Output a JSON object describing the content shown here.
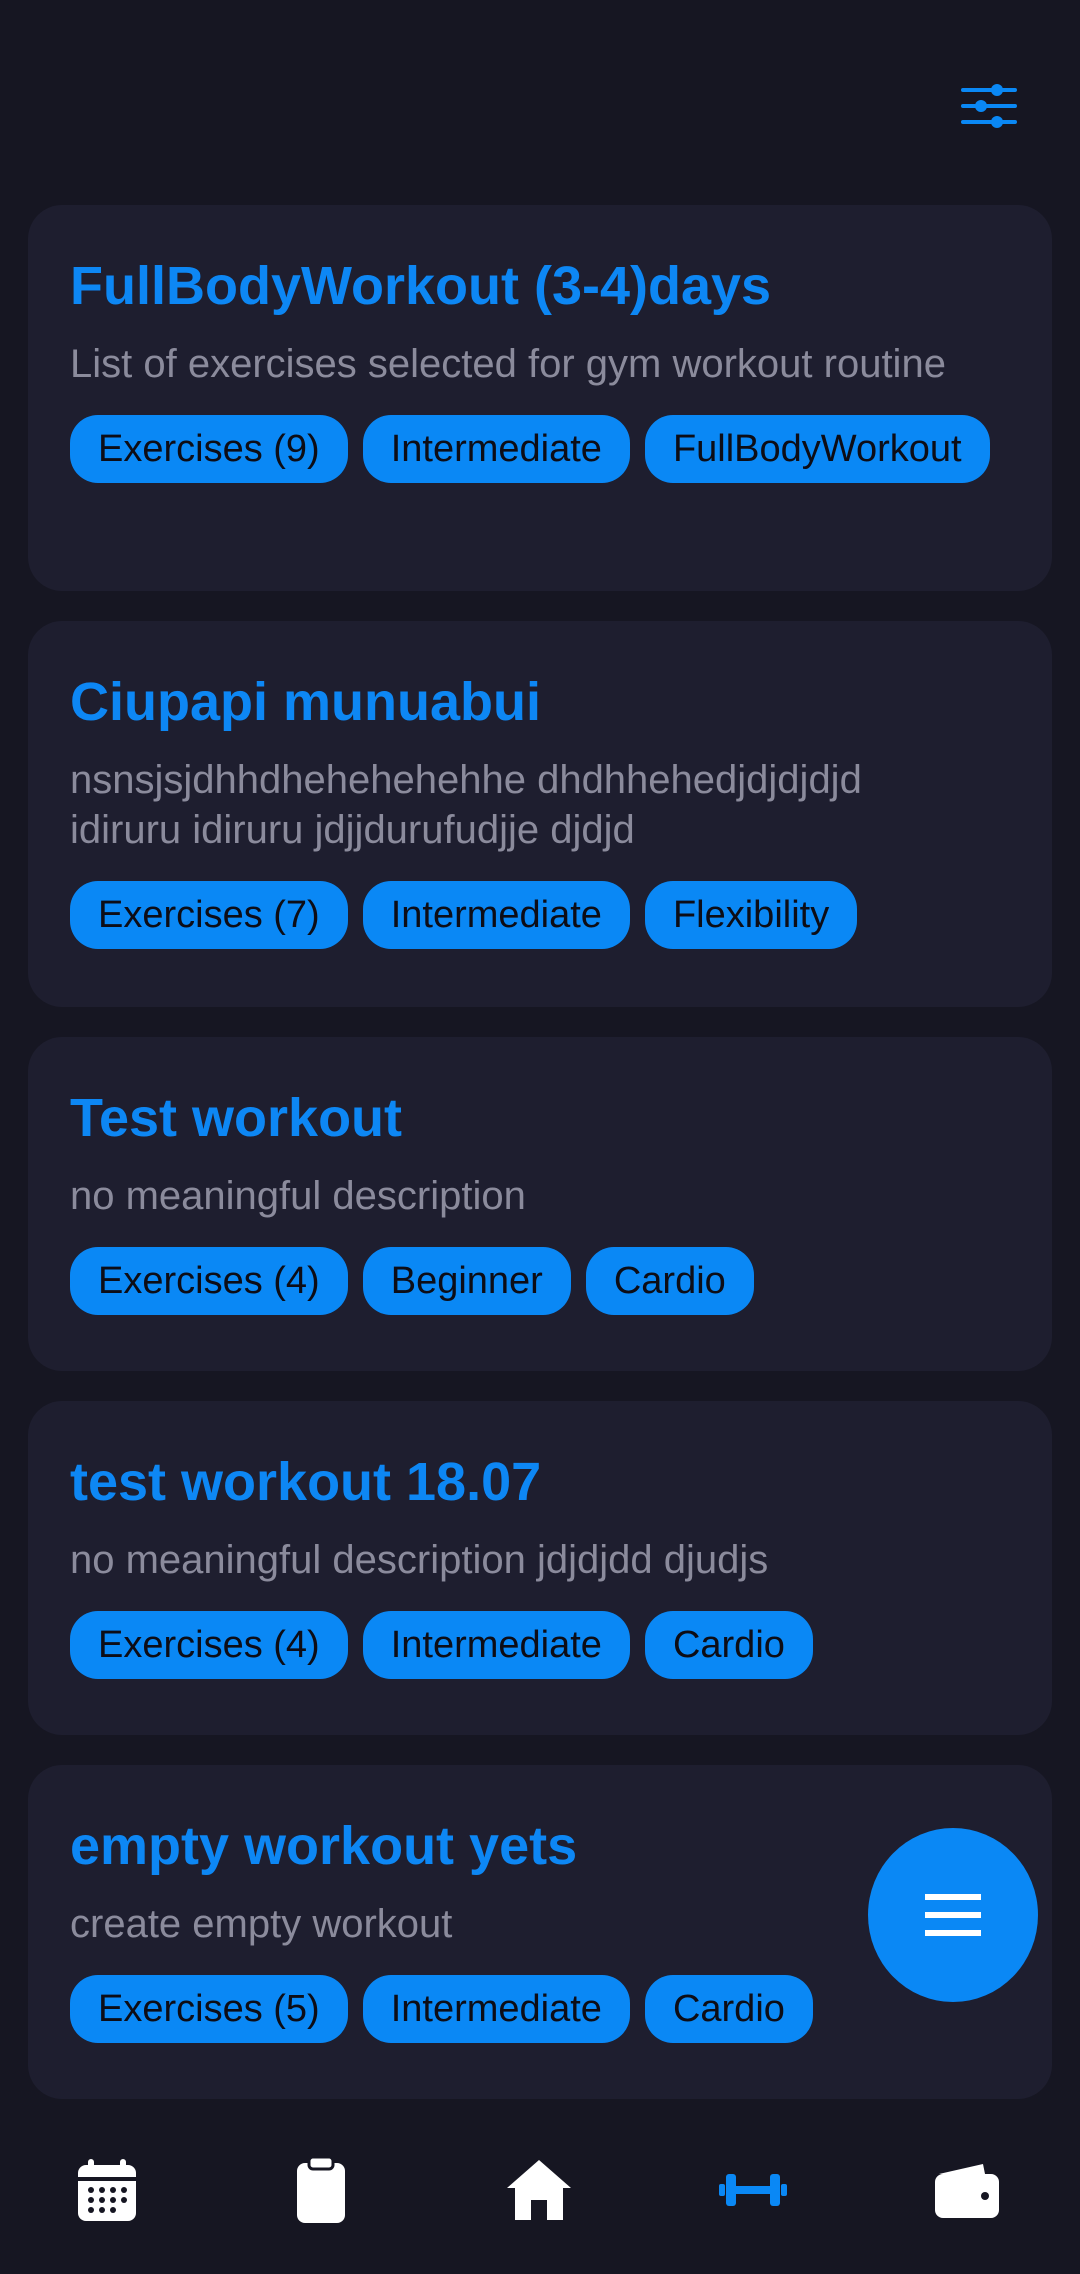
{
  "colors": {
    "background": "#161622",
    "card": "#1e1e2f",
    "accent": "#0a88f5",
    "title": "#0d87f4",
    "description": "#8b8b9c",
    "nav_icon": "#ffffff",
    "nav_active": "#0a88f5"
  },
  "header": {
    "filter_icon": "sliders-icon"
  },
  "workouts": [
    {
      "title": "FullBodyWorkout (3-4)days",
      "description": "List of exercises selected for gym workout routine",
      "tags": [
        "Exercises (9)",
        "Intermediate",
        "FullBodyWorkout"
      ]
    },
    {
      "title": "Ciupapi munuabui",
      "description": "nsnsjsjdhhdhehehehehhe dhdhhehedjdjdjdjd idiruru idiruru jdjjdurufudjje djdjd",
      "tags": [
        "Exercises (7)",
        "Intermediate",
        "Flexibility"
      ]
    },
    {
      "title": "Test workout",
      "description": "no meaningful description",
      "tags": [
        "Exercises (4)",
        "Beginner",
        "Cardio"
      ]
    },
    {
      "title": "test workout 18.07",
      "description": "no meaningful description jdjdjdd djudjs",
      "tags": [
        "Exercises (4)",
        "Intermediate",
        "Cardio"
      ]
    },
    {
      "title": "empty workout yets",
      "description": "create empty workout",
      "tags": [
        "Exercises (5)",
        "Intermediate",
        "Cardio"
      ]
    }
  ],
  "fab": {
    "icon": "menu-icon"
  },
  "bottom_nav": [
    {
      "icon": "calendar-icon",
      "active": false
    },
    {
      "icon": "clipboard-icon",
      "active": false
    },
    {
      "icon": "home-icon",
      "active": false
    },
    {
      "icon": "dumbbell-icon",
      "active": true
    },
    {
      "icon": "wallet-icon",
      "active": false
    }
  ]
}
